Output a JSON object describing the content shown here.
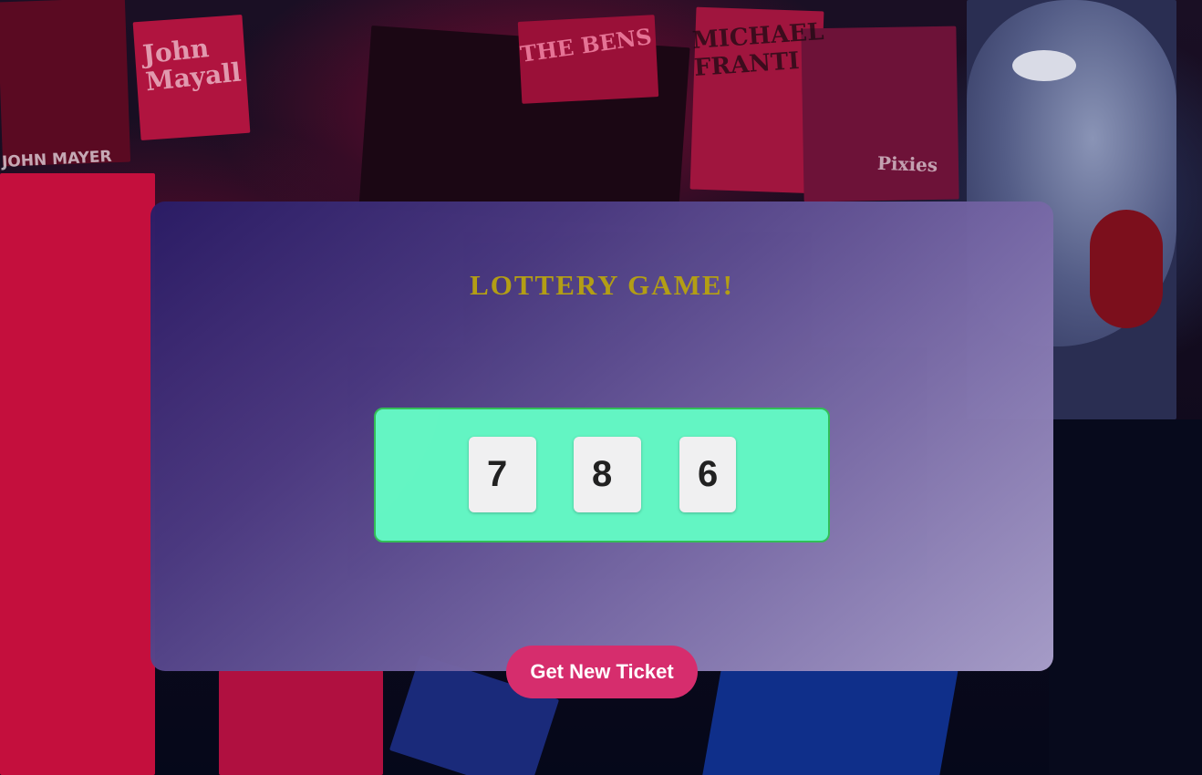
{
  "game": {
    "title": "LOTTERY GAME!",
    "ticket_digits": [
      "7",
      "8",
      "6"
    ],
    "new_ticket_button": "Get New Ticket"
  },
  "background": {
    "poster_texts": [
      "John\nMayall",
      "JOHN MAYER",
      "THE BENS",
      "MICHAEL\nFRANTI",
      "Pixies"
    ]
  },
  "colors": {
    "title": "#b9a315",
    "ticket_background": "#66fdc9",
    "ticket_border": "#34c45a",
    "button": "#d62d6d",
    "card_gradient_start": "#2a1c66",
    "card_gradient_end": "#aaa0cc"
  }
}
